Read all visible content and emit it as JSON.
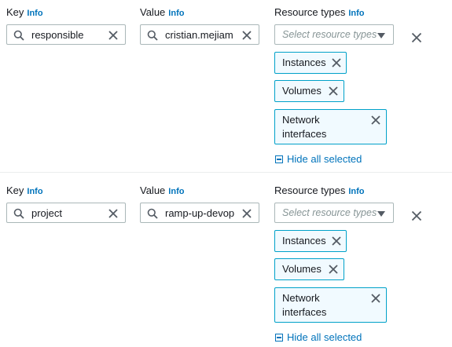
{
  "labels": {
    "key": "Key",
    "value": "Value",
    "resource_types": "Resource types",
    "info": "Info"
  },
  "select_placeholder": "Select resource types",
  "hide_all_label": "Hide all selected",
  "tags": [
    {
      "key": "responsible",
      "value": "cristian.mejiam",
      "resource_types": [
        "Instances",
        "Volumes",
        "Network interfaces"
      ]
    },
    {
      "key": "project",
      "value": "ramp-up-devop",
      "resource_types": [
        "Instances",
        "Volumes",
        "Network interfaces"
      ]
    }
  ],
  "colors": {
    "link": "#0073bb",
    "token_border": "#00a1c9",
    "token_bg": "#f1faff",
    "input_border": "#aab7b8"
  }
}
